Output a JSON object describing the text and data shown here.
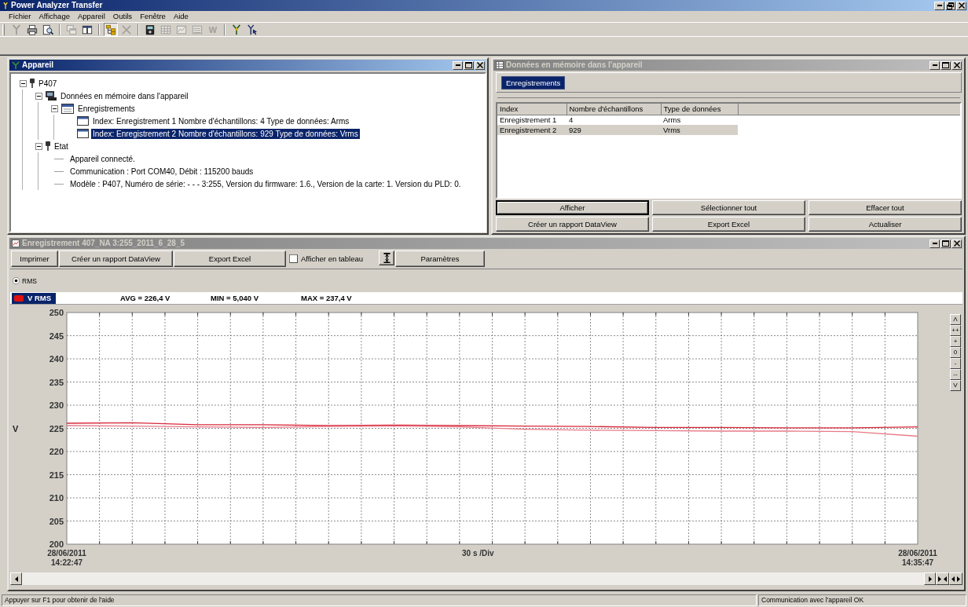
{
  "window": {
    "title": "Power Analyzer Transfer"
  },
  "menu": [
    "Fichier",
    "Affichage",
    "Appareil",
    "Outils",
    "Fenêtre",
    "Aide"
  ],
  "toolbar": [
    {
      "kind": "button",
      "disabled": true,
      "pressed": false
    },
    {
      "kind": "button",
      "disabled": false,
      "pressed": false
    },
    {
      "kind": "button",
      "disabled": false,
      "pressed": false
    },
    {
      "kind": "separator"
    },
    {
      "kind": "button",
      "disabled": true,
      "pressed": false
    },
    {
      "kind": "button",
      "disabled": false,
      "pressed": false
    },
    {
      "kind": "separator"
    },
    {
      "kind": "button",
      "disabled": false,
      "pressed": true
    },
    {
      "kind": "button",
      "disabled": true,
      "pressed": false
    },
    {
      "kind": "separator"
    },
    {
      "kind": "button",
      "disabled": false,
      "pressed": false
    },
    {
      "kind": "button",
      "disabled": true,
      "pressed": false
    },
    {
      "kind": "button",
      "disabled": true,
      "pressed": false
    },
    {
      "kind": "button",
      "disabled": true,
      "pressed": false
    },
    {
      "kind": "button",
      "label": "W",
      "disabled": true,
      "pressed": false
    },
    {
      "kind": "separator"
    },
    {
      "kind": "button",
      "disabled": false,
      "pressed": false
    },
    {
      "kind": "button",
      "disabled": false,
      "pressed": false
    }
  ],
  "device_window": {
    "title": "Appareil",
    "active": true,
    "tree": [
      {
        "kind": "device",
        "label": "P407",
        "expanded": true,
        "selected": false,
        "children": [
          {
            "kind": "memory",
            "label": "Données en mémoire dans l'appareil",
            "expanded": true,
            "selected": false,
            "children": [
              {
                "kind": "folder",
                "label": "Enregistrements",
                "expanded": true,
                "selected": false,
                "children": [
                  {
                    "kind": "record",
                    "label": "Index: Enregistrement 1 Nombre d'échantillons: 4 Type de données: Arms",
                    "selected": false
                  },
                  {
                    "kind": "record",
                    "label": "Index: Enregistrement 2 Nombre d'échantillons: 929 Type de données: Vrms",
                    "selected": true
                  }
                ]
              }
            ]
          },
          {
            "kind": "device",
            "label": "Etat",
            "expanded": true,
            "selected": false,
            "children": [
              {
                "kind": "info",
                "label": "Appareil connecté.",
                "selected": false
              },
              {
                "kind": "info",
                "label": "Communication : Port COM40, Débit : 115200 bauds",
                "selected": false
              },
              {
                "kind": "info",
                "label": "Modèle : P407, Numéro de série: - - - 3:255, Version du firmware: 1.6., Version de la carte: 1. Version du PLD: 0.",
                "selected": false
              }
            ]
          }
        ]
      }
    ]
  },
  "memory_window": {
    "title": "Données en mémoire dans l'appareil",
    "active": false,
    "tabs": [
      {
        "label": "Enregistrements",
        "selected": true
      }
    ],
    "table": {
      "columns": [
        "Index",
        "Nombre d'échantillons",
        "Type de données"
      ],
      "rows": [
        {
          "cells": [
            "Enregistrement 1",
            "4",
            "Arms"
          ],
          "selected": false
        },
        {
          "cells": [
            "Enregistrement 2",
            "929",
            "Vrms"
          ],
          "selected": true
        }
      ]
    },
    "buttons": [
      {
        "label": "Afficher",
        "focused": true
      },
      {
        "label": "Sélectionner tout",
        "focused": false
      },
      {
        "label": "Effacer tout",
        "focused": false
      },
      {
        "label": "Créer un rapport DataView",
        "focused": false
      },
      {
        "label": "Export Excel",
        "focused": false
      },
      {
        "label": "Actualiser",
        "focused": false
      }
    ]
  },
  "record_window": {
    "title": "Enregistrement 407_NA 3:255_2011_6_28_5",
    "active": false,
    "toolbar": [
      {
        "kind": "button",
        "label": "Imprimer"
      },
      {
        "kind": "button",
        "label": "Créer un rapport DataView"
      },
      {
        "kind": "button",
        "label": "Export Excel"
      },
      {
        "kind": "checkbox",
        "label": "Afficher en tableau",
        "checked": false
      },
      {
        "kind": "icon"
      },
      {
        "kind": "button",
        "label": "Paramètres"
      }
    ],
    "modes": [
      {
        "label": "RMS",
        "selected": true
      }
    ],
    "legend": {
      "label": "V RMS",
      "color": "#e01010",
      "selected": true
    },
    "stats": [
      "AVG = 226,4 V",
      "MIN = 5,040 V",
      "MAX = 237,4 V"
    ],
    "chart_data": {
      "type": "line",
      "xlabel": "30 s /Div",
      "ylabel": "V",
      "x": [
        "2011-06-28T14:22:47",
        "2011-06-28T14:23:47",
        "2011-06-28T14:24:47",
        "2011-06-28T14:25:47",
        "2011-06-28T14:26:47",
        "2011-06-28T14:27:47",
        "2011-06-28T14:28:47",
        "2011-06-28T14:29:47",
        "2011-06-28T14:30:47",
        "2011-06-28T14:31:47",
        "2011-06-28T14:32:47",
        "2011-06-28T14:33:47",
        "2011-06-28T14:34:47",
        "2011-06-28T14:35:47"
      ],
      "series": [
        {
          "color": "#d8283a",
          "values": [
            226.1,
            226.2,
            225.8,
            225.8,
            225.6,
            225.7,
            225.6,
            225.5,
            225.4,
            225.2,
            225.2,
            225.1,
            225.1,
            225.3
          ]
        },
        {
          "color": "#e87a88",
          "values": [
            225.6,
            225.5,
            225.3,
            225.2,
            225.4,
            225.5,
            225.3,
            224.8,
            224.6,
            224.5,
            224.4,
            224.4,
            224.3,
            223.3
          ]
        }
      ],
      "xlim": [
        "2011-06-28T14:22:47",
        "2011-06-28T14:35:47"
      ],
      "ylim": [
        200,
        250
      ],
      "yticks": [
        200,
        205,
        210,
        215,
        220,
        225,
        230,
        235,
        240,
        245,
        250
      ],
      "xticks": [
        {
          "value": "2011-06-28T14:22:47",
          "label": "28/06/2011 14:22:47"
        },
        {
          "value": "2011-06-28T14:35:47",
          "label": "28/06/2011 14:35:47"
        }
      ],
      "grid": true
    },
    "zoom_buttons": [
      "Λ",
      "++",
      "+",
      "0",
      "-",
      "--",
      "V"
    ]
  },
  "status_bar": {
    "left": "Appuyer sur F1 pour obtenir de l'aide",
    "right": "Communication avec l'appareil OK"
  }
}
